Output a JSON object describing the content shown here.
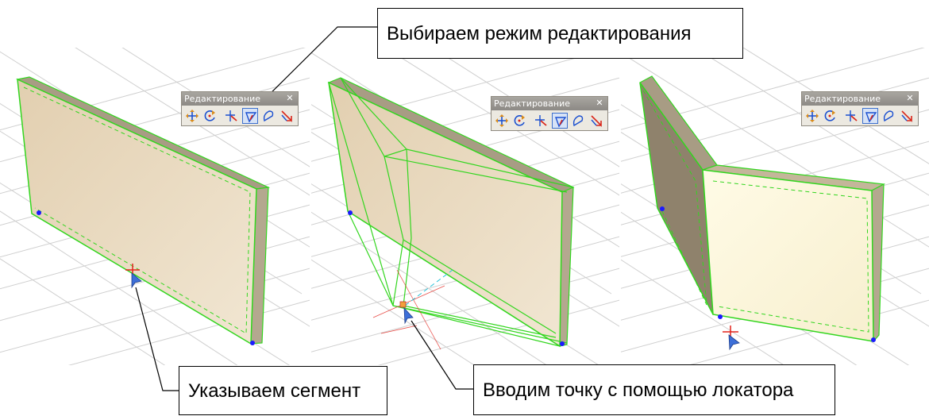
{
  "toolbar": {
    "title": "Редактирование",
    "close": "✕",
    "buttons": [
      "move-icon",
      "rotate-icon",
      "edit-point-icon",
      "edit-segment-icon",
      "arc-icon",
      "break-icon"
    ],
    "active_button": "edit-segment-icon"
  },
  "callouts": {
    "select_mode": "Выбираем режим редактирования",
    "pick_segment": "Указываем сегмент",
    "enter_point": "Вводим точку с помощью локатора"
  },
  "colors": {
    "wall_fill": "#e6d6bc",
    "wall_edge": "#33d61f",
    "grid": "#cfcfcf",
    "vertex": "#1a1aff",
    "cursor": "#3d6fd8",
    "locator": "#e3231c"
  }
}
